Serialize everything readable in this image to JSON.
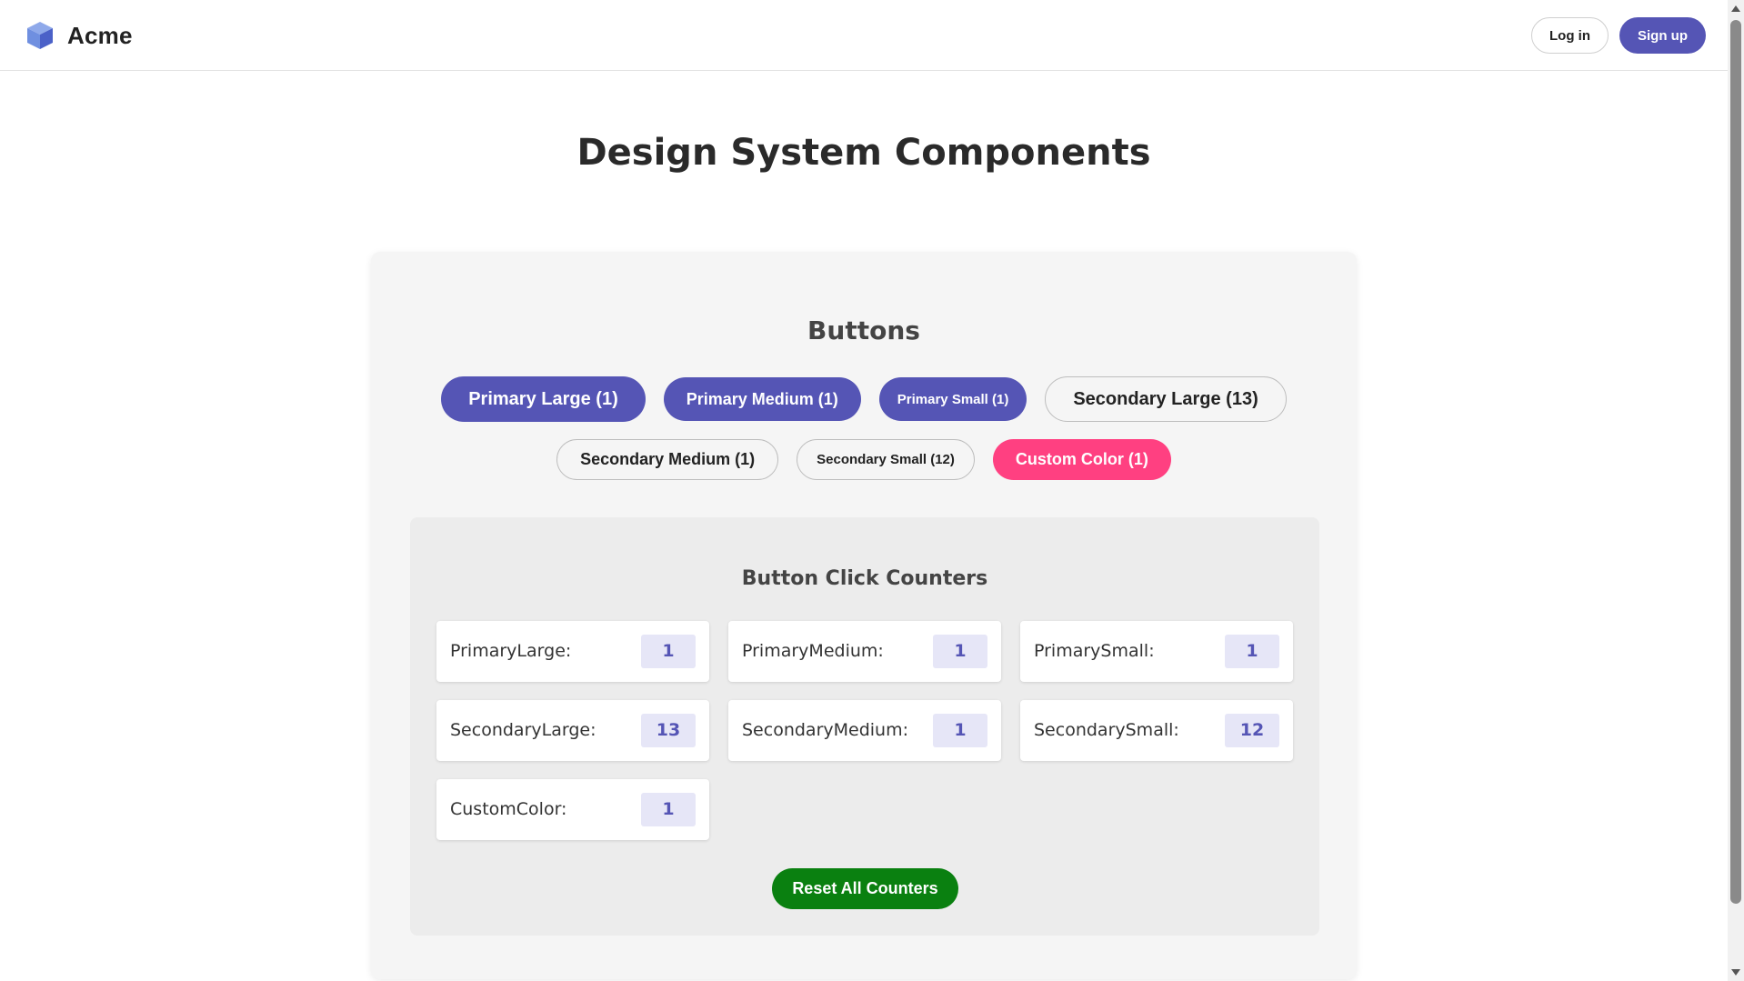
{
  "header": {
    "brand_name": "Acme",
    "login_label": "Log in",
    "signup_label": "Sign up"
  },
  "main": {
    "page_title": "Design System Components",
    "buttons_section_title": "Buttons",
    "buttons": [
      {
        "label": "Primary Large (1)"
      },
      {
        "label": "Primary Medium (1)"
      },
      {
        "label": "Primary Small (1)"
      },
      {
        "label": "Secondary Large (13)"
      },
      {
        "label": "Secondary Medium (1)"
      },
      {
        "label": "Secondary Small (12)"
      },
      {
        "label": "Custom Color (1)"
      }
    ],
    "counters_title": "Button Click Counters",
    "counters": [
      {
        "label": "PrimaryLarge:",
        "value": "1"
      },
      {
        "label": "PrimaryMedium:",
        "value": "1"
      },
      {
        "label": "PrimarySmall:",
        "value": "1"
      },
      {
        "label": "SecondaryLarge:",
        "value": "13"
      },
      {
        "label": "SecondaryMedium:",
        "value": "1"
      },
      {
        "label": "SecondarySmall:",
        "value": "12"
      },
      {
        "label": "CustomColor:",
        "value": "1"
      }
    ],
    "reset_label": "Reset All Counters"
  },
  "colors": {
    "primary": "#5555b5",
    "custom": "#ff4081",
    "reset": "#0a8010",
    "counter_value_bg": "#e6e6f7"
  },
  "icons": {
    "brand": "cube-logo-icon"
  }
}
